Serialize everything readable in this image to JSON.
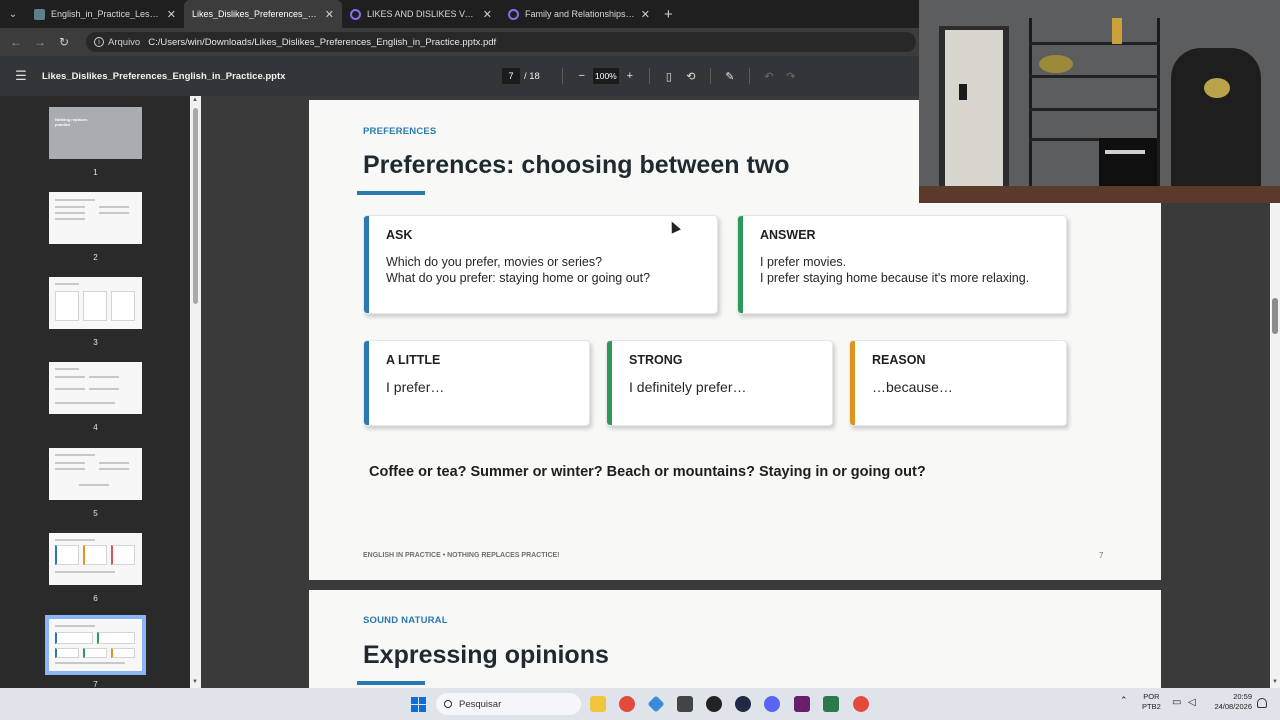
{
  "tabs": [
    {
      "title": "English_in_Practice_Lesson_04_",
      "active": false,
      "icon": "pdf-icon"
    },
    {
      "title": "Likes_Dislikes_Preferences_Engl",
      "active": true,
      "icon": "pdf-icon"
    },
    {
      "title": "LIKES AND DISLIKES Vocabulary",
      "active": false,
      "icon": "quizlet-icon"
    },
    {
      "title": "Family and Relationships Vocab",
      "active": false,
      "icon": "quizlet-icon"
    }
  ],
  "address": {
    "chip": "Arquivo",
    "url": "C:/Users/win/Downloads/Likes_Dislikes_Preferences_English_in_Practice.pptx.pdf"
  },
  "pdf_toolbar": {
    "title": "Likes_Dislikes_Preferences_English_in_Practice.pptx",
    "page_current": "7",
    "page_total": "/ 18",
    "zoom": "100%"
  },
  "thumbnails": [
    {
      "label": "1",
      "title": "Nothing replaces practice"
    },
    {
      "label": "2"
    },
    {
      "label": "3"
    },
    {
      "label": "4"
    },
    {
      "label": "5"
    },
    {
      "label": "6"
    },
    {
      "label": "7",
      "selected": true
    }
  ],
  "slide7": {
    "kicker": "PREFERENCES",
    "title": "Preferences: choosing between two",
    "ask": {
      "label": "ASK",
      "line1": "Which do you prefer, movies or series?",
      "line2": "What do you prefer: staying home or going out?"
    },
    "answer": {
      "label": "ANSWER",
      "line1": "I prefer movies.",
      "line2": "I prefer staying home because it's more relaxing."
    },
    "a_little": {
      "label": "A LITTLE",
      "text": "I prefer…"
    },
    "strong": {
      "label": "STRONG",
      "text": "I definitely prefer…"
    },
    "reason": {
      "label": "REASON",
      "text": "…because…"
    },
    "prompt": "Coffee or tea? Summer or winter? Beach or mountains? Staying in or going out?",
    "footer": "ENGLISH IN PRACTICE  •  NOTHING REPLACES PRACTICE!",
    "page_number": "7"
  },
  "slide8": {
    "kicker": "SOUND NATURAL",
    "title": "Expressing opinions"
  },
  "colors": {
    "blue": "#2a7ab0",
    "green": "#2e9a5a",
    "orange": "#e0931f"
  },
  "taskbar": {
    "search_placeholder": "Pesquisar",
    "lang_line1": "POR",
    "lang_line2": "PTB2",
    "time": "20:59",
    "date": "24/08/2026"
  }
}
